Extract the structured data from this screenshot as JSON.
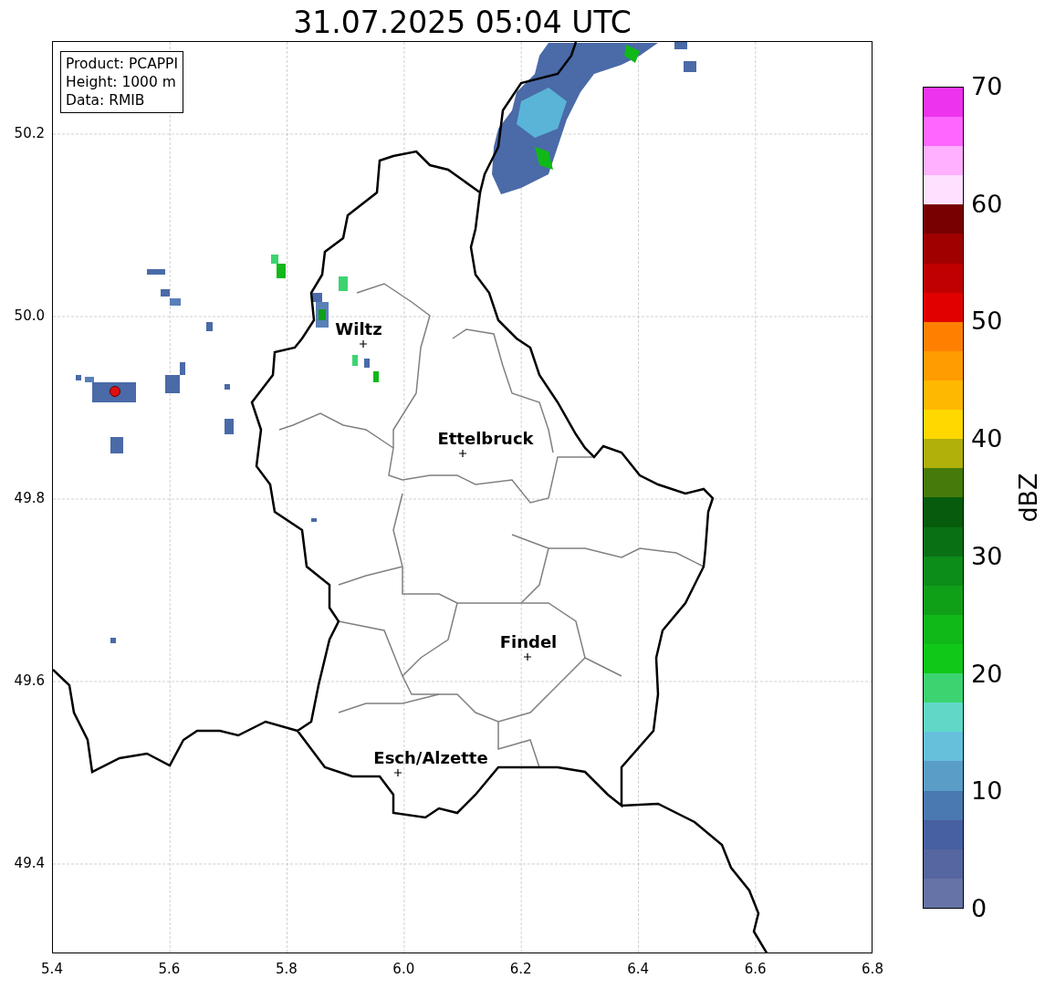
{
  "title": "31.07.2025 05:04 UTC",
  "info_box": [
    "Product: PCAPPI",
    "Height: 1000 m",
    "Data: RMIB"
  ],
  "map": {
    "x_ticks": [
      "5.4",
      "5.6",
      "5.8",
      "6.0",
      "6.2",
      "6.4",
      "6.6",
      "6.8"
    ],
    "y_ticks": [
      "50.2",
      "50.0",
      "49.8",
      "49.6",
      "49.4"
    ],
    "cities": [
      {
        "name": "Wiltz"
      },
      {
        "name": "Ettelbruck"
      },
      {
        "name": "Findel"
      },
      {
        "name": "Esch/Alzette"
      }
    ]
  },
  "colorbar": {
    "label": "dBZ",
    "ticks": [
      "70",
      "60",
      "50",
      "40",
      "30",
      "20",
      "10",
      "0"
    ],
    "bands": [
      {
        "color": "#6673a6"
      },
      {
        "color": "#5566a0"
      },
      {
        "color": "#4760a2"
      },
      {
        "color": "#4a78b0"
      },
      {
        "color": "#5a9ec8"
      },
      {
        "color": "#66c0dc"
      },
      {
        "color": "#60d8c8"
      },
      {
        "color": "#3cd470"
      },
      {
        "color": "#10c818"
      },
      {
        "color": "#10b818"
      },
      {
        "color": "#10a018"
      },
      {
        "color": "#0c8c18"
      },
      {
        "color": "#0a7014"
      },
      {
        "color": "#065c0c"
      },
      {
        "color": "#467a0a"
      },
      {
        "color": "#b0b00a"
      },
      {
        "color": "#ffd800"
      },
      {
        "color": "#ffb800"
      },
      {
        "color": "#ff9c00"
      },
      {
        "color": "#ff8000"
      },
      {
        "color": "#e00000"
      },
      {
        "color": "#c00000"
      },
      {
        "color": "#a00000"
      },
      {
        "color": "#780000"
      },
      {
        "color": "#ffe0ff"
      },
      {
        "color": "#ffb0ff"
      },
      {
        "color": "#ff66ff"
      },
      {
        "color": "#ee33ee"
      }
    ]
  }
}
